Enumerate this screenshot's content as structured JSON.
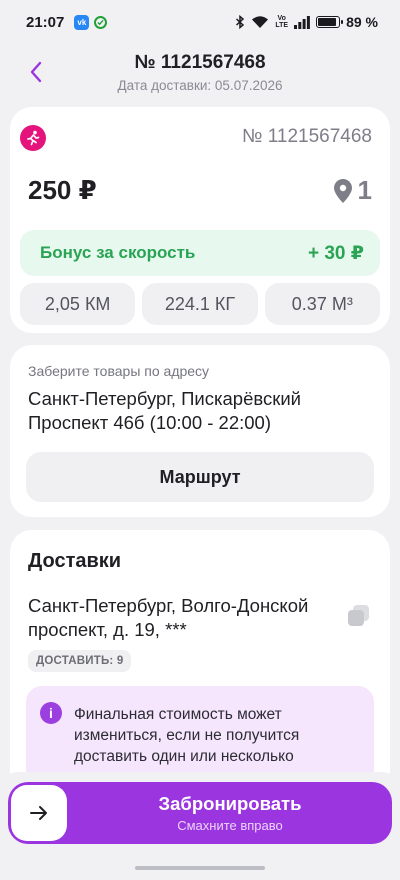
{
  "status_bar": {
    "time": "21:07",
    "vk_label": "vk",
    "volte_top": "Vo",
    "volte_bottom": "LTE",
    "battery_percent": "89 %",
    "battery_level": 0.89
  },
  "header": {
    "title": "№ 1121567468",
    "subtitle": "Дата доставки: 05.07.2026"
  },
  "order_card": {
    "order_number": "№ 1121567468",
    "price": "250 ₽",
    "points_count": "1",
    "bonus_label": "Бонус за скорость",
    "bonus_value": "+ 30 ₽",
    "stats": {
      "distance": "2,05 КМ",
      "weight": "224.1 КГ",
      "volume": "0.37 М³"
    }
  },
  "pickup": {
    "hint": "Заберите товары по адресу",
    "address": "Санкт-Петербург, Пискарёвский Проспект 46б (10:00 - 22:00)",
    "route_button": "Маршрут"
  },
  "deliveries": {
    "title": "Доставки",
    "address": "Санкт-Петербург, Волго-Донской проспект, д. 19, ***",
    "chip": "ДОСТАВИТЬ: 9",
    "info_icon_glyph": "i",
    "info_text": "Финальная стоимость может измениться, если не получится доставить один или несколько"
  },
  "booking": {
    "title": "Забронировать",
    "subtitle": "Смахните вправо"
  },
  "icons": {
    "back": "chevron-left-icon",
    "runner": "runner-icon",
    "pin": "map-pin-icon",
    "copy": "copy-icon",
    "arrow": "arrow-right-icon"
  },
  "colors": {
    "accent_purple": "#9b35e0",
    "runner_pink": "#e4147c",
    "bonus_green": "#2aa454",
    "bonus_bg": "#e7f8ee",
    "info_bg": "#f5e5fd"
  }
}
